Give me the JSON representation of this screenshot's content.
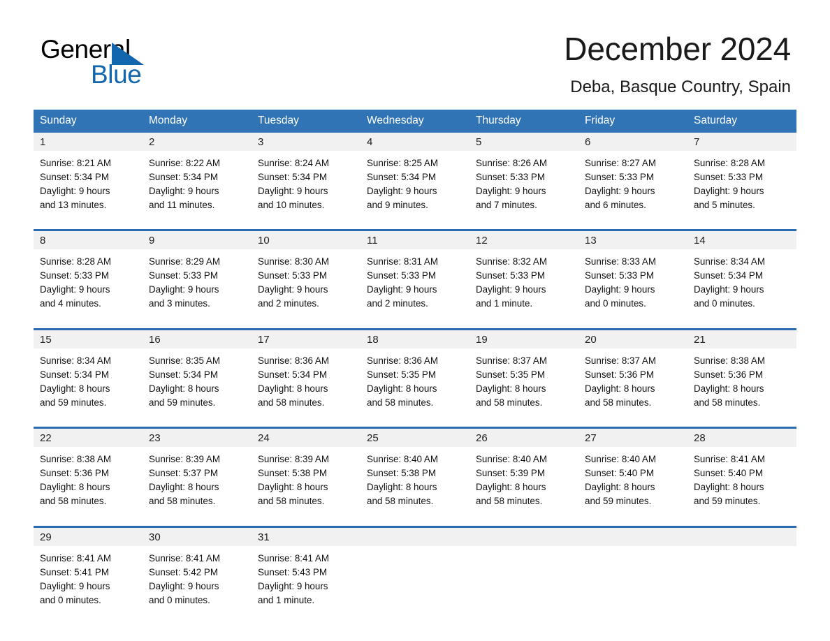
{
  "brand": {
    "word_one": "General",
    "word_two": "Blue",
    "triangle_color": "#1266ad",
    "triangle_icon": "triangle-icon"
  },
  "header": {
    "title": "December 2024",
    "location": "Deba, Basque Country, Spain"
  },
  "theme": {
    "header_blue": "#3074b5",
    "row_rule_blue": "#2b6cb0",
    "daynum_band": "#f1f1f1",
    "text": "#111111"
  },
  "calendar": {
    "weekday_headers": [
      "Sunday",
      "Monday",
      "Tuesday",
      "Wednesday",
      "Thursday",
      "Friday",
      "Saturday"
    ],
    "weeks": [
      [
        {
          "day": "1",
          "sunrise": "Sunrise: 8:21 AM",
          "sunset": "Sunset: 5:34 PM",
          "daylight_1": "Daylight: 9 hours",
          "daylight_2": "and 13 minutes."
        },
        {
          "day": "2",
          "sunrise": "Sunrise: 8:22 AM",
          "sunset": "Sunset: 5:34 PM",
          "daylight_1": "Daylight: 9 hours",
          "daylight_2": "and 11 minutes."
        },
        {
          "day": "3",
          "sunrise": "Sunrise: 8:24 AM",
          "sunset": "Sunset: 5:34 PM",
          "daylight_1": "Daylight: 9 hours",
          "daylight_2": "and 10 minutes."
        },
        {
          "day": "4",
          "sunrise": "Sunrise: 8:25 AM",
          "sunset": "Sunset: 5:34 PM",
          "daylight_1": "Daylight: 9 hours",
          "daylight_2": "and 9 minutes."
        },
        {
          "day": "5",
          "sunrise": "Sunrise: 8:26 AM",
          "sunset": "Sunset: 5:33 PM",
          "daylight_1": "Daylight: 9 hours",
          "daylight_2": "and 7 minutes."
        },
        {
          "day": "6",
          "sunrise": "Sunrise: 8:27 AM",
          "sunset": "Sunset: 5:33 PM",
          "daylight_1": "Daylight: 9 hours",
          "daylight_2": "and 6 minutes."
        },
        {
          "day": "7",
          "sunrise": "Sunrise: 8:28 AM",
          "sunset": "Sunset: 5:33 PM",
          "daylight_1": "Daylight: 9 hours",
          "daylight_2": "and 5 minutes."
        }
      ],
      [
        {
          "day": "8",
          "sunrise": "Sunrise: 8:28 AM",
          "sunset": "Sunset: 5:33 PM",
          "daylight_1": "Daylight: 9 hours",
          "daylight_2": "and 4 minutes."
        },
        {
          "day": "9",
          "sunrise": "Sunrise: 8:29 AM",
          "sunset": "Sunset: 5:33 PM",
          "daylight_1": "Daylight: 9 hours",
          "daylight_2": "and 3 minutes."
        },
        {
          "day": "10",
          "sunrise": "Sunrise: 8:30 AM",
          "sunset": "Sunset: 5:33 PM",
          "daylight_1": "Daylight: 9 hours",
          "daylight_2": "and 2 minutes."
        },
        {
          "day": "11",
          "sunrise": "Sunrise: 8:31 AM",
          "sunset": "Sunset: 5:33 PM",
          "daylight_1": "Daylight: 9 hours",
          "daylight_2": "and 2 minutes."
        },
        {
          "day": "12",
          "sunrise": "Sunrise: 8:32 AM",
          "sunset": "Sunset: 5:33 PM",
          "daylight_1": "Daylight: 9 hours",
          "daylight_2": "and 1 minute."
        },
        {
          "day": "13",
          "sunrise": "Sunrise: 8:33 AM",
          "sunset": "Sunset: 5:33 PM",
          "daylight_1": "Daylight: 9 hours",
          "daylight_2": "and 0 minutes."
        },
        {
          "day": "14",
          "sunrise": "Sunrise: 8:34 AM",
          "sunset": "Sunset: 5:34 PM",
          "daylight_1": "Daylight: 9 hours",
          "daylight_2": "and 0 minutes."
        }
      ],
      [
        {
          "day": "15",
          "sunrise": "Sunrise: 8:34 AM",
          "sunset": "Sunset: 5:34 PM",
          "daylight_1": "Daylight: 8 hours",
          "daylight_2": "and 59 minutes."
        },
        {
          "day": "16",
          "sunrise": "Sunrise: 8:35 AM",
          "sunset": "Sunset: 5:34 PM",
          "daylight_1": "Daylight: 8 hours",
          "daylight_2": "and 59 minutes."
        },
        {
          "day": "17",
          "sunrise": "Sunrise: 8:36 AM",
          "sunset": "Sunset: 5:34 PM",
          "daylight_1": "Daylight: 8 hours",
          "daylight_2": "and 58 minutes."
        },
        {
          "day": "18",
          "sunrise": "Sunrise: 8:36 AM",
          "sunset": "Sunset: 5:35 PM",
          "daylight_1": "Daylight: 8 hours",
          "daylight_2": "and 58 minutes."
        },
        {
          "day": "19",
          "sunrise": "Sunrise: 8:37 AM",
          "sunset": "Sunset: 5:35 PM",
          "daylight_1": "Daylight: 8 hours",
          "daylight_2": "and 58 minutes."
        },
        {
          "day": "20",
          "sunrise": "Sunrise: 8:37 AM",
          "sunset": "Sunset: 5:36 PM",
          "daylight_1": "Daylight: 8 hours",
          "daylight_2": "and 58 minutes."
        },
        {
          "day": "21",
          "sunrise": "Sunrise: 8:38 AM",
          "sunset": "Sunset: 5:36 PM",
          "daylight_1": "Daylight: 8 hours",
          "daylight_2": "and 58 minutes."
        }
      ],
      [
        {
          "day": "22",
          "sunrise": "Sunrise: 8:38 AM",
          "sunset": "Sunset: 5:36 PM",
          "daylight_1": "Daylight: 8 hours",
          "daylight_2": "and 58 minutes."
        },
        {
          "day": "23",
          "sunrise": "Sunrise: 8:39 AM",
          "sunset": "Sunset: 5:37 PM",
          "daylight_1": "Daylight: 8 hours",
          "daylight_2": "and 58 minutes."
        },
        {
          "day": "24",
          "sunrise": "Sunrise: 8:39 AM",
          "sunset": "Sunset: 5:38 PM",
          "daylight_1": "Daylight: 8 hours",
          "daylight_2": "and 58 minutes."
        },
        {
          "day": "25",
          "sunrise": "Sunrise: 8:40 AM",
          "sunset": "Sunset: 5:38 PM",
          "daylight_1": "Daylight: 8 hours",
          "daylight_2": "and 58 minutes."
        },
        {
          "day": "26",
          "sunrise": "Sunrise: 8:40 AM",
          "sunset": "Sunset: 5:39 PM",
          "daylight_1": "Daylight: 8 hours",
          "daylight_2": "and 58 minutes."
        },
        {
          "day": "27",
          "sunrise": "Sunrise: 8:40 AM",
          "sunset": "Sunset: 5:40 PM",
          "daylight_1": "Daylight: 8 hours",
          "daylight_2": "and 59 minutes."
        },
        {
          "day": "28",
          "sunrise": "Sunrise: 8:41 AM",
          "sunset": "Sunset: 5:40 PM",
          "daylight_1": "Daylight: 8 hours",
          "daylight_2": "and 59 minutes."
        }
      ],
      [
        {
          "day": "29",
          "sunrise": "Sunrise: 8:41 AM",
          "sunset": "Sunset: 5:41 PM",
          "daylight_1": "Daylight: 9 hours",
          "daylight_2": "and 0 minutes."
        },
        {
          "day": "30",
          "sunrise": "Sunrise: 8:41 AM",
          "sunset": "Sunset: 5:42 PM",
          "daylight_1": "Daylight: 9 hours",
          "daylight_2": "and 0 minutes."
        },
        {
          "day": "31",
          "sunrise": "Sunrise: 8:41 AM",
          "sunset": "Sunset: 5:43 PM",
          "daylight_1": "Daylight: 9 hours",
          "daylight_2": "and 1 minute."
        },
        {
          "day": "",
          "sunrise": "",
          "sunset": "",
          "daylight_1": "",
          "daylight_2": ""
        },
        {
          "day": "",
          "sunrise": "",
          "sunset": "",
          "daylight_1": "",
          "daylight_2": ""
        },
        {
          "day": "",
          "sunrise": "",
          "sunset": "",
          "daylight_1": "",
          "daylight_2": ""
        },
        {
          "day": "",
          "sunrise": "",
          "sunset": "",
          "daylight_1": "",
          "daylight_2": ""
        }
      ]
    ]
  }
}
